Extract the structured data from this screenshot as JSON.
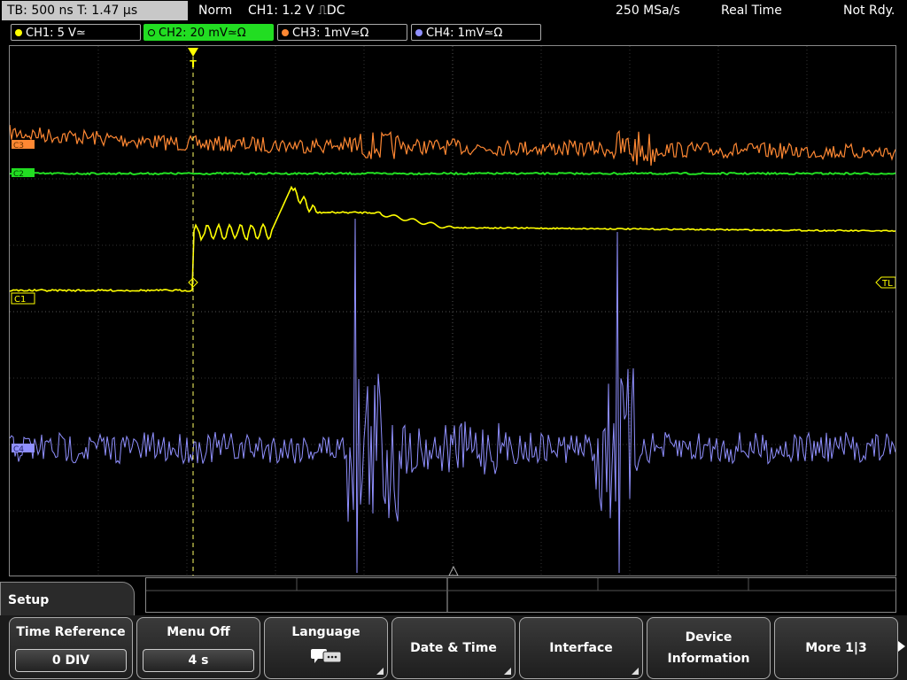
{
  "status": {
    "timebase": "TB: 500 ns   T: 1.47 µs",
    "mode": "Norm",
    "trigger": "CH1: 1.2 V ⎍DC",
    "sample_rate": "250 MSa/s",
    "acq": "Real Time",
    "state": "Not Rdy."
  },
  "channels": [
    {
      "label": "CH1: 5 V≃",
      "color": "#ffff00",
      "active": false
    },
    {
      "label": "CH2: 20 mV≃Ω",
      "color": "#22dd22",
      "active": true
    },
    {
      "label": "CH3: 1mV≃Ω",
      "color": "#ff8833",
      "active": false
    },
    {
      "label": "CH4: 1mV≃Ω",
      "color": "#9090ff",
      "active": false
    }
  ],
  "markers": {
    "c1": "C1",
    "tl": "TL",
    "trig": "T",
    "c2": "C2",
    "c3": "C3",
    "c4": "C4"
  },
  "menu": {
    "title": "Setup",
    "keys": [
      {
        "label": "Time Reference",
        "value": "0 DIV"
      },
      {
        "label": "Menu Off",
        "value": "4 s"
      },
      {
        "label": "Language",
        "icon": "speech-bubbles-icon"
      },
      {
        "label": "Date & Time"
      },
      {
        "label": "Interface"
      },
      {
        "label": "Device\nInformation"
      },
      {
        "label": "More 1|3"
      }
    ]
  }
}
